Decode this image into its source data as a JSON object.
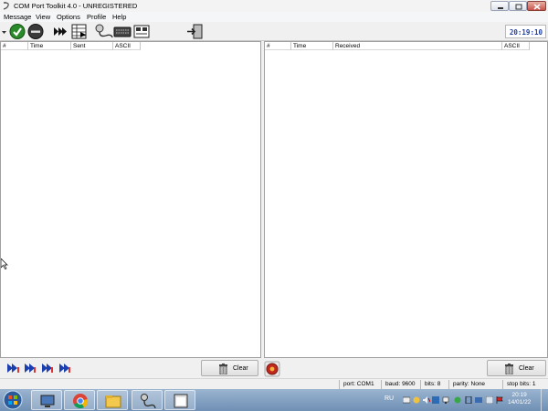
{
  "window": {
    "title": "COM Port Toolkit 4.0 - UNREGISTERED"
  },
  "menu": [
    "Message",
    "View",
    "Options",
    "Profile",
    "Help"
  ],
  "toolbar": {
    "clock": "20:19:10",
    "icons": [
      "dropdown-arrow-icon",
      "connect-check-icon",
      "disconnect-icon",
      "send-all-icon",
      "send-table-icon",
      "port-settings-icon",
      "keyboard-icon",
      "terminal-icon",
      "exit-icon"
    ]
  },
  "sent_pane": {
    "columns": [
      "#",
      "Time",
      "Sent",
      "ASCII"
    ]
  },
  "received_pane": {
    "columns": [
      "#",
      "Time",
      "Received",
      "ASCII"
    ]
  },
  "actions": {
    "clear_label_left": "Clear",
    "clear_label_right": "Clear"
  },
  "status": {
    "port": "port: COM1",
    "baud": "baud: 9600",
    "bits": "bits: 8",
    "parity": "parity: None",
    "stop_bits": "stop bits: 1"
  },
  "taskbar": {
    "language": "RU",
    "time": "20:19",
    "date": "14/01/22"
  },
  "colors": {
    "clock_text": "#1f3da0",
    "connect_green": "#2a8a2a",
    "disconnect_dark": "#3a3a3a",
    "taskbar": "#7f9cbf"
  }
}
